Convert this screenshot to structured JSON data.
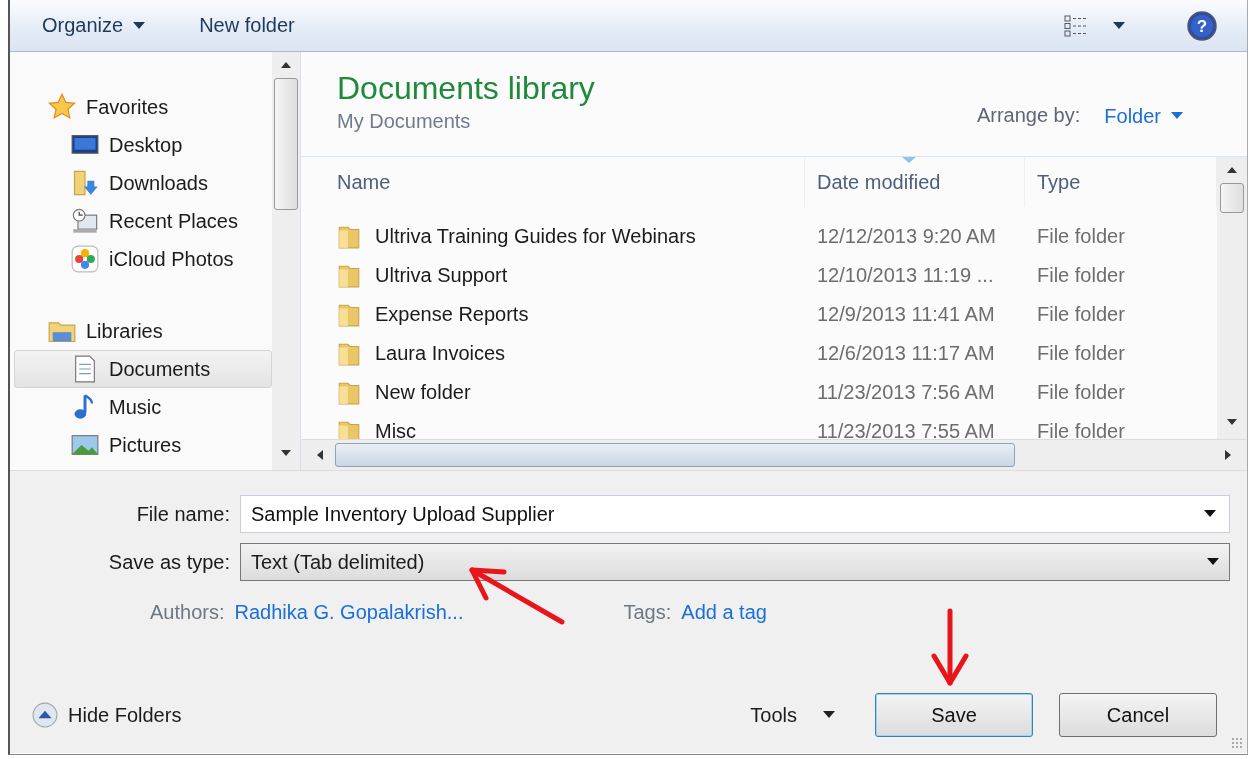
{
  "toolbar": {
    "organize": "Organize",
    "new_folder": "New folder",
    "help": "?"
  },
  "nav": {
    "groups": [
      {
        "label": "Favorites",
        "kind": "favorites",
        "items": [
          {
            "label": "Desktop",
            "kind": "desktop",
            "selected": false
          },
          {
            "label": "Downloads",
            "kind": "downloads",
            "selected": false
          },
          {
            "label": "Recent Places",
            "kind": "recent",
            "selected": false
          },
          {
            "label": "iCloud Photos",
            "kind": "photos",
            "selected": false
          }
        ]
      },
      {
        "label": "Libraries",
        "kind": "libraries",
        "items": [
          {
            "label": "Documents",
            "kind": "documents",
            "selected": true
          },
          {
            "label": "Music",
            "kind": "music",
            "selected": false
          },
          {
            "label": "Pictures",
            "kind": "pictures",
            "selected": false
          }
        ]
      }
    ]
  },
  "library": {
    "title": "Documents library",
    "subtitle": "My Documents",
    "arrange_label": "Arrange by:",
    "arrange_value": "Folder"
  },
  "table": {
    "columns": [
      "Name",
      "Date modified",
      "Type"
    ],
    "rows": [
      {
        "name": "Ultriva Training Guides for Webinars",
        "date": "12/12/2013 9:20 AM",
        "type": "File folder"
      },
      {
        "name": "Ultriva Support",
        "date": "12/10/2013 11:19 ...",
        "type": "File folder"
      },
      {
        "name": "Expense Reports",
        "date": "12/9/2013 11:41 AM",
        "type": "File folder"
      },
      {
        "name": "Laura Invoices",
        "date": "12/6/2013 11:17 AM",
        "type": "File folder"
      },
      {
        "name": "New folder",
        "date": "11/23/2013 7:56 AM",
        "type": "File folder"
      },
      {
        "name": "Misc",
        "date": "11/23/2013 7:55 AM",
        "type": "File folder"
      }
    ]
  },
  "form": {
    "file_name_label": "File name:",
    "file_name": "Sample Inventory Upload Supplier",
    "type_label": "Save as type:",
    "type_value": "Text (Tab delimited)",
    "authors_label": "Authors:",
    "authors": "Radhika G. Gopalakrish...",
    "tags_label": "Tags:",
    "tags": "Add a tag"
  },
  "footer": {
    "hide_folders": "Hide Folders",
    "tools": "Tools",
    "buttons": [
      "Save",
      "Cancel"
    ]
  }
}
